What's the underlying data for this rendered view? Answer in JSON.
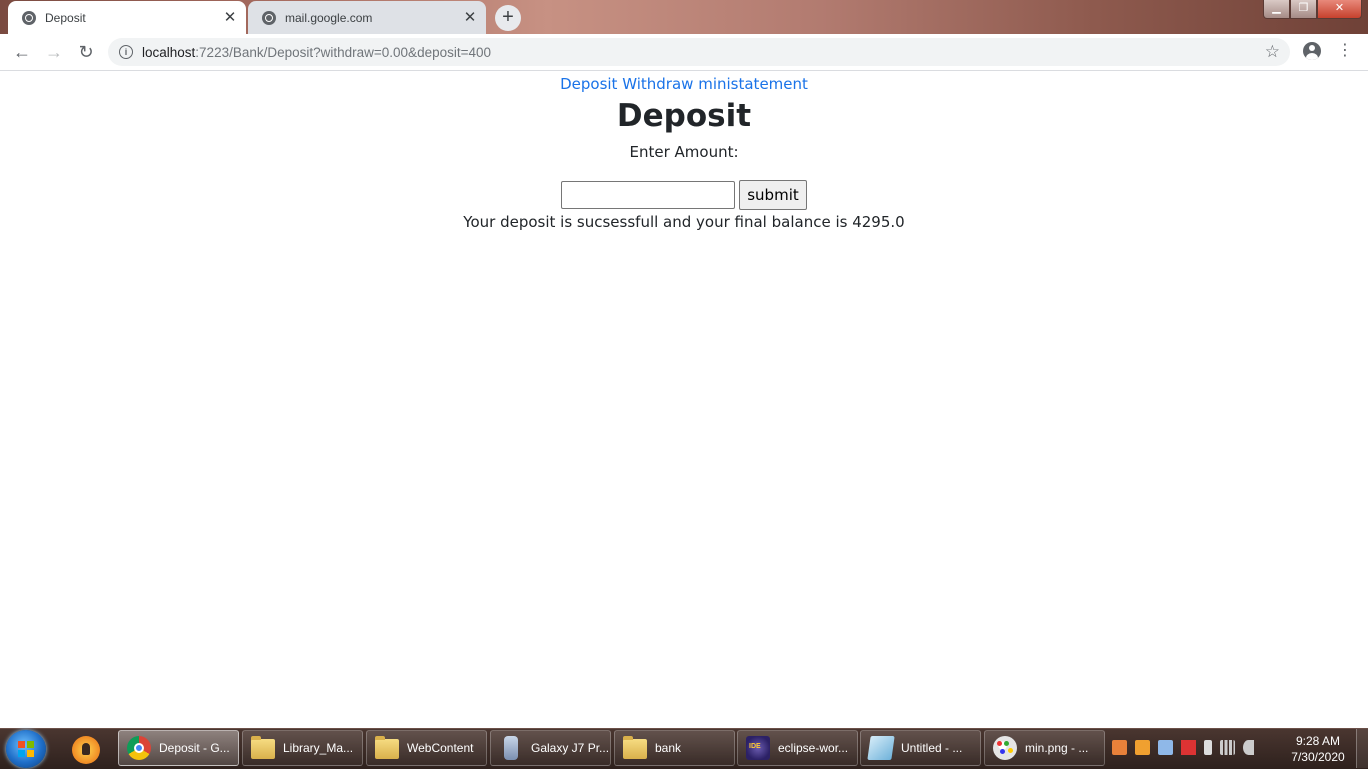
{
  "browser": {
    "tabs": [
      {
        "title": "Deposit",
        "active": true
      },
      {
        "title": "mail.google.com",
        "active": false
      }
    ],
    "address": {
      "host": "localhost",
      "rest": ":7223/Bank/Deposit?withdraw=0.00&deposit=400"
    }
  },
  "page": {
    "nav_links": [
      "Deposit",
      "Withdraw",
      "ministatement"
    ],
    "heading": "Deposit",
    "amount_label": "Enter Amount:",
    "amount_value": "",
    "submit_label": "submit",
    "result_message": "Your deposit is sucsessfull and your final balance is 4295.0"
  },
  "taskbar": {
    "items": [
      {
        "label": "Deposit - G...",
        "icon": "chrome-icon",
        "active": true
      },
      {
        "label": "Library_Ma...",
        "icon": "folder-icon",
        "active": false
      },
      {
        "label": "WebContent",
        "icon": "folder-icon",
        "active": false
      },
      {
        "label": "Galaxy J7 Pr...",
        "icon": "phone-icon",
        "active": false
      },
      {
        "label": "bank",
        "icon": "folder-icon",
        "active": false
      },
      {
        "label": "eclipse-wor...",
        "icon": "eclipse-icon",
        "active": false
      },
      {
        "label": "Untitled - ...",
        "icon": "notepad-icon",
        "active": false
      },
      {
        "label": "min.png - ...",
        "icon": "paint-icon",
        "active": false
      }
    ],
    "clock_time": "9:28 AM",
    "clock_date": "7/30/2020"
  }
}
